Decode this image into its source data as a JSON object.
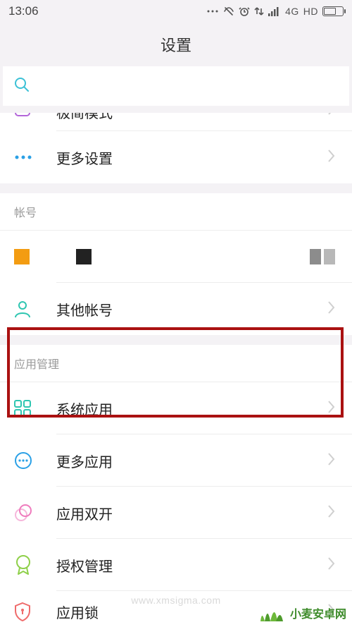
{
  "status": {
    "time": "13:06",
    "network": "4G",
    "hd": "HD"
  },
  "title": "设置",
  "search": {
    "placeholder": ""
  },
  "rows": {
    "partial": {
      "label": "极简模式"
    },
    "more": {
      "label": "更多设置"
    },
    "accounts_header": "帐号",
    "other_acc": {
      "label": "其他帐号"
    },
    "apps_header": "应用管理",
    "sys_apps": {
      "label": "系统应用"
    },
    "more_apps": {
      "label": "更多应用"
    },
    "dual_apps": {
      "label": "应用双开"
    },
    "perm": {
      "label": "授权管理"
    },
    "app_lock": {
      "label": "应用锁"
    }
  },
  "watermark": {
    "brand": "小麦安卓网",
    "url": "www.xmsigma.com"
  }
}
